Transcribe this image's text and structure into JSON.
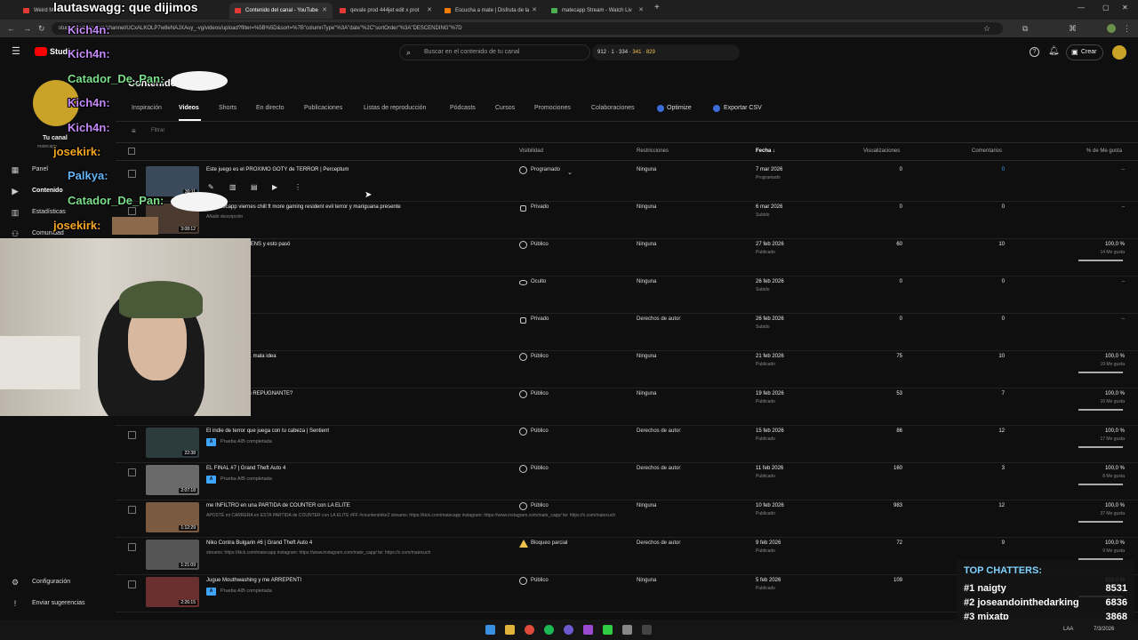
{
  "browser": {
    "tabs": [
      {
        "label": "Weird Mo...",
        "color": "#e53935"
      },
      {
        "label": "Contenido del canal - YouTube",
        "color": "#e53935"
      },
      {
        "label": "qevale prod 444jet edit x prot",
        "color": "#e53935"
      },
      {
        "label": "Escucha a mate | Disfruta de la",
        "color": "#f57c00"
      },
      {
        "label": "matecapp Stream - Watch Liv",
        "color": "#4caf50"
      }
    ],
    "new_tab": "+",
    "url": "studio.youtube.com/channel/UCxALKOLP7w8eNAJXAuy_-vg/videos/upload?filter=%5B%5D&sort=%7B\"columnType\"%3A\"date\"%2C\"sortOrder\"%3A\"DESCENDING\"%7D"
  },
  "studio": {
    "logo": "Studio",
    "search_placeholder": "Buscar en el contenido de tu canal",
    "stats": [
      "912",
      "1",
      "334",
      "341",
      "829"
    ],
    "create_label": "Crear"
  },
  "sidebar": {
    "channel_label": "Tu canal",
    "channel_sub": "matecapp",
    "items": [
      {
        "label": "Panel",
        "icon": "dashboard-icon"
      },
      {
        "label": "Contenido",
        "icon": "content-icon"
      },
      {
        "label": "Estadísticas",
        "icon": "analytics-icon"
      },
      {
        "label": "Comunidad",
        "icon": "community-icon"
      }
    ],
    "settings": "Configuración",
    "feedback": "Enviar sugerencias"
  },
  "page": {
    "title": "Contenido",
    "filter_label": "Filtrar",
    "tabs": [
      "Inspiración",
      "Videos",
      "Shorts",
      "En directo",
      "Publicaciones",
      "Listas de reproducción",
      "Pódcasts",
      "Cursos",
      "Promociones",
      "Colaboraciones",
      "Optimize",
      "Exportar CSV"
    ],
    "active_tab": "Videos"
  },
  "table": {
    "columns": {
      "visibility": "Visibilidad",
      "restrictions": "Restricciones",
      "date": "Fecha",
      "views": "Visualizaciones",
      "comments": "Comentarios",
      "likes": "% de Me gusta"
    },
    "rows": [
      {
        "title": "Este juego es el PROXIMO GOTY de TERROR | Perceptum",
        "desc": "",
        "duration": "30:11",
        "visibility": "Programado",
        "vis_icon": "clock",
        "restriction": "Ninguna",
        "date": "7 mar 2026",
        "date_sub": "Programado",
        "views": "0",
        "comments": "0",
        "likes": "–",
        "likes_sub": "",
        "thumb": "#3a4a5a"
      },
      {
        "title": "27 matecapp viernes chill ft more gaming resident evil terror y mariguana presente",
        "desc": "Añadir descripción",
        "duration": "3:08:12",
        "visibility": "Privado",
        "vis_icon": "lock",
        "restriction": "Ninguna",
        "date": "6 mar 2026",
        "date_sub": "Subido",
        "views": "0",
        "comments": "0",
        "likes": "–",
        "likes_sub": "",
        "thumb": "#4a3a30"
      },
      {
        "title": "secretos sobre ALIENS y esto pasó",
        "desc": "en curso",
        "duration": "",
        "visibility": "Público",
        "vis_icon": "globe",
        "restriction": "Ninguna",
        "date": "27 feb 2026",
        "date_sub": "Publicado",
        "views": "60",
        "comments": "10",
        "likes": "100,0 %",
        "likes_sub": "14 Me gusta",
        "thumb": ""
      },
      {
        "title": "",
        "desc": "",
        "duration": "",
        "visibility": "Oculto",
        "vis_icon": "eye",
        "restriction": "Ninguna",
        "date": "26 feb 2026",
        "date_sub": "Subido",
        "views": "0",
        "comments": "0",
        "likes": "–",
        "likes_sub": "",
        "thumb": ""
      },
      {
        "title": "",
        "desc": "",
        "duration": "",
        "visibility": "Privado",
        "vis_icon": "lock",
        "restriction": "Derechos de autor",
        "date": "26 feb 2026",
        "date_sub": "Subido",
        "views": "0",
        "comments": "0",
        "likes": "–",
        "likes_sub": "",
        "thumb": ""
      },
      {
        "title": "empezar TLOU 2... mala idea",
        "desc": "en curso",
        "duration": "",
        "visibility": "Público",
        "vis_icon": "globe",
        "restriction": "Ninguna",
        "date": "21 feb 2026",
        "date_sub": "Publicado",
        "views": "75",
        "comments": "10",
        "likes": "100,0 %",
        "likes_sub": "19 Me gusta",
        "thumb": ""
      },
      {
        "title": "juego de horror tan REPUGNANTE?",
        "desc": "completada",
        "duration": "",
        "visibility": "Público",
        "vis_icon": "globe",
        "restriction": "Ninguna",
        "date": "19 feb 2026",
        "date_sub": "Publicado",
        "views": "53",
        "comments": "7",
        "likes": "100,0 %",
        "likes_sub": "16 Me gusta",
        "thumb": ""
      },
      {
        "title": "El indie de terror que juega con tu cabeza | Sentient",
        "desc": "",
        "ab": "Prueba A/B completada",
        "duration": "22:38",
        "visibility": "Público",
        "vis_icon": "globe",
        "restriction": "Derechos de autor",
        "date": "15 feb 2026",
        "date_sub": "Publicado",
        "views": "86",
        "comments": "12",
        "likes": "100,0 %",
        "likes_sub": "17 Me gusta",
        "thumb": "#2c3b3c"
      },
      {
        "title": "EL FINAL #7 | Grand Theft Auto 4",
        "desc": "",
        "ab": "Prueba A/B completada",
        "duration": "2:07:18",
        "visibility": "Público",
        "vis_icon": "globe",
        "restriction": "Derechos de autor",
        "date": "11 feb 2026",
        "date_sub": "Publicado",
        "views": "160",
        "comments": "3",
        "likes": "100,0 %",
        "likes_sub": "8 Me gusta",
        "thumb": "#6a6a6a"
      },
      {
        "title": "me INFILTRO en una PARTIDA de COUNTER con LA ELITE",
        "desc": "APOSTÉ mi CARRERA en ESTA PARTIDA de COUNTER con LA ELITE #FF #counterstrike2 streams: https://kick.com/matecapp instagram: https://www.instagram.com/mate_capp/ tw: https://x.com/matecuch",
        "duration": "1:12:29",
        "visibility": "Público",
        "vis_icon": "globe",
        "restriction": "Ninguna",
        "date": "10 feb 2026",
        "date_sub": "Publicado",
        "views": "983",
        "comments": "12",
        "likes": "100,0 %",
        "likes_sub": "37 Me gusta",
        "thumb": "#7a5a40"
      },
      {
        "title": "Niko Contra Bulgarin #6 | Grand Theft Auto 4",
        "desc": "streams: https://kick.com/matecapp instagram: https://www.instagram.com/mate_capp/ tw: https://x.com/matecuch",
        "duration": "1:21:09",
        "visibility": "Bloqueo parcial",
        "vis_icon": "warn",
        "restriction": "Derechos de autor",
        "date": "9 feb 2026",
        "date_sub": "Publicado",
        "views": "72",
        "comments": "9",
        "likes": "100,0 %",
        "likes_sub": "9 Me gusta",
        "thumb": "#555555"
      },
      {
        "title": "Jugue Mouthwashing y me ARREPENTI",
        "desc": "",
        "ab": "Prueba A/B completada",
        "duration": "2:26:15",
        "visibility": "Público",
        "vis_icon": "globe",
        "restriction": "Ninguna",
        "date": "5 feb 2026",
        "date_sub": "Publicado",
        "views": "109",
        "comments": "",
        "likes": "100,0 %",
        "likes_sub": "",
        "thumb": "#6a3030"
      }
    ]
  },
  "overlay": {
    "top_text": "lautaswagg: que dijimos",
    "chat": [
      {
        "user": "Kich4n:",
        "color": "#c58af9"
      },
      {
        "user": "Kich4n:",
        "color": "#c58af9"
      },
      {
        "user": "Catador_De_Pan:",
        "color": "#7be08a"
      },
      {
        "user": "Kich4n:",
        "color": "#c58af9"
      },
      {
        "user": "Kich4n:",
        "color": "#c58af9"
      },
      {
        "user": "josekirk:",
        "color": "#f5a623"
      },
      {
        "user": "Palkya:",
        "color": "#64b5f6"
      },
      {
        "user": "Catador_De_Pan:",
        "color": "#7be08a"
      },
      {
        "user": "josekirk:",
        "color": "#f5a623"
      }
    ],
    "top_chatters_title": "TOP CHATTERS:",
    "top_chatters": [
      {
        "rank": "#1",
        "name": "naigty",
        "value": "8531"
      },
      {
        "rank": "#2",
        "name": "joseandointhedarking",
        "value": "6836"
      },
      {
        "rank": "#3",
        "name": "mixatp",
        "value": "3868"
      }
    ]
  },
  "taskbar": {
    "time": "7/3/2026",
    "lang": "LAA"
  }
}
